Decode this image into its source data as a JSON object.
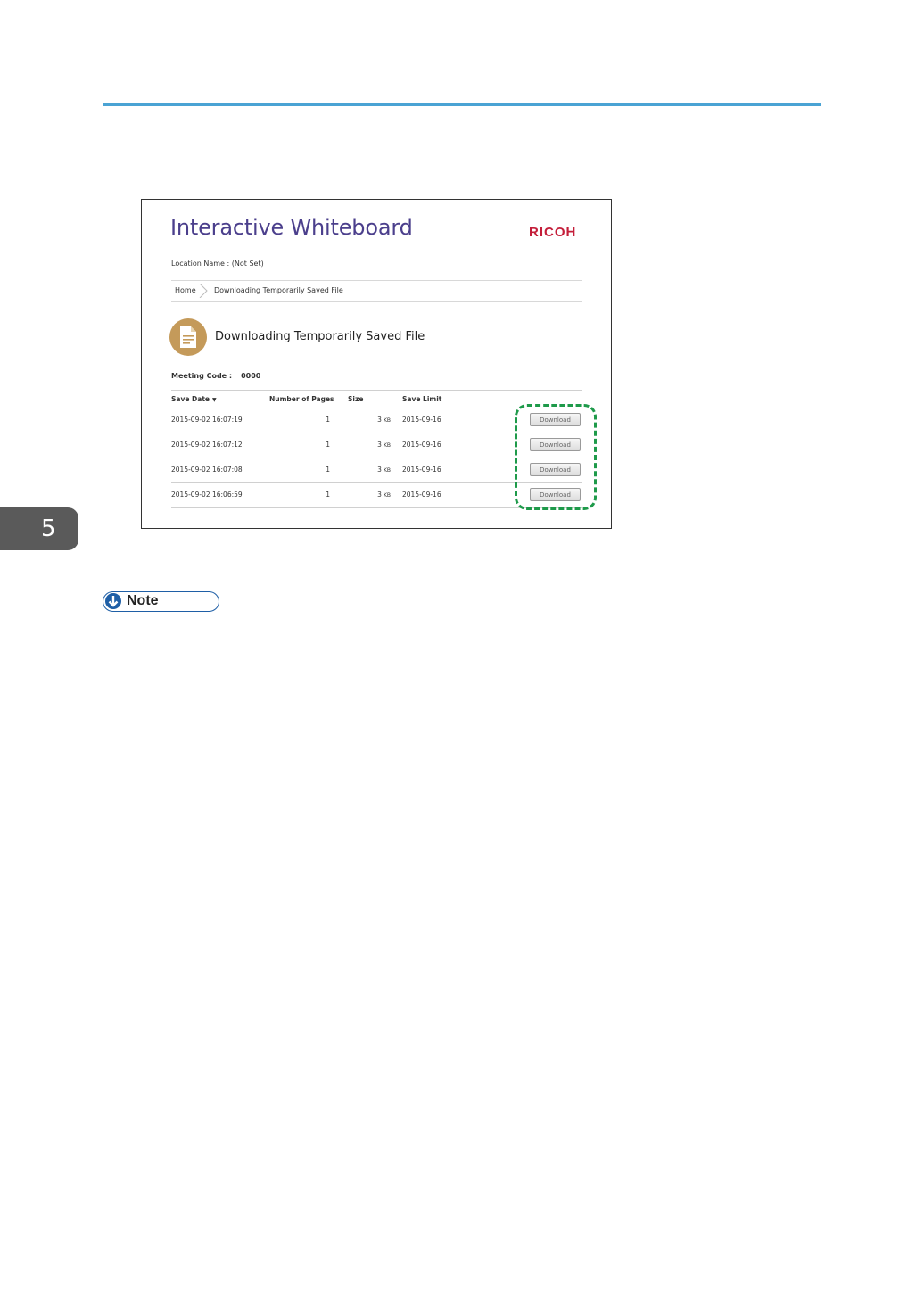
{
  "chapter": {
    "number": "5"
  },
  "app": {
    "title": "Interactive Whiteboard",
    "brand": "RICOH",
    "location": "Location Name : (Not Set)"
  },
  "breadcrumb": {
    "home": "Home",
    "current": "Downloading Temporarily Saved File"
  },
  "page": {
    "heading": "Downloading Temporarily Saved File",
    "icon": "file-document-icon",
    "meeting_code_label": "Meeting Code :",
    "meeting_code_value": "0000"
  },
  "table": {
    "headers": {
      "save_date": "Save Date",
      "pages": "Number of Pages",
      "size": "Size",
      "save_limit": "Save Limit"
    },
    "sort_indicator": "▼",
    "size_unit": "KB",
    "download_label": "Download",
    "rows": [
      {
        "save_date": "2015-09-02  16:07:19",
        "pages": "1",
        "size": "3",
        "save_limit": "2015-09-16"
      },
      {
        "save_date": "2015-09-02  16:07:12",
        "pages": "1",
        "size": "3",
        "save_limit": "2015-09-16"
      },
      {
        "save_date": "2015-09-02  16:07:08",
        "pages": "1",
        "size": "3",
        "save_limit": "2015-09-16"
      },
      {
        "save_date": "2015-09-02  16:06:59",
        "pages": "1",
        "size": "3",
        "save_limit": "2015-09-16"
      }
    ]
  },
  "note": {
    "label": "Note",
    "icon": "arrow-down-icon"
  },
  "colors": {
    "rule": "#4aa3d4",
    "title": "#4b3f8c",
    "brand": "#c41e3a",
    "highlight": "#1e9a4a",
    "note": "#1f5fa6",
    "page_icon": "#c49a5a"
  }
}
